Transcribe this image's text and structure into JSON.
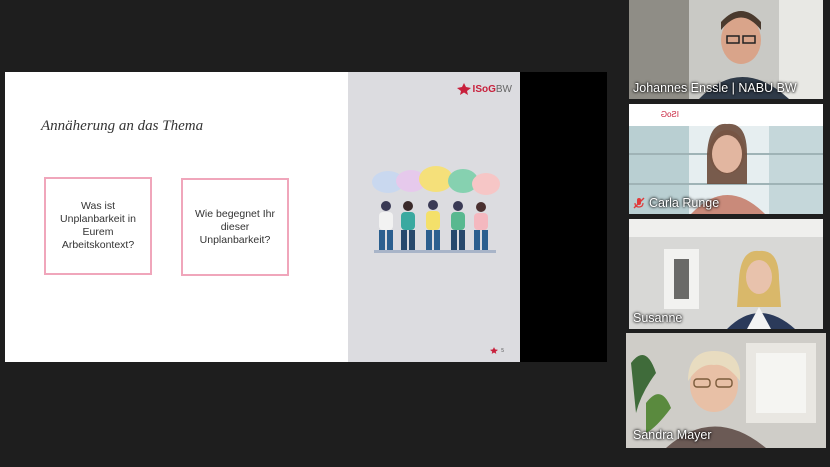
{
  "slide": {
    "title": "Annäherung an das Thema",
    "question1": "Was ist Unplanbarkeit in Eurem Arbeitskontext?",
    "question2": "Wie begegnet Ihr dieser Unplanbarkeit?",
    "logo_text": "ISoG",
    "logo_suffix": "BW",
    "page_number": "5"
  },
  "participants": [
    {
      "name": "Johannes Enssle | NABU BW",
      "muted": false,
      "active": false
    },
    {
      "name": "Carla Runge",
      "muted": true,
      "active": false
    },
    {
      "name": "Susanne",
      "muted": false,
      "active": false
    },
    {
      "name": "Sandra Mayer",
      "muted": false,
      "active": true
    }
  ],
  "colors": {
    "accent_box_border": "#f0a6bb",
    "logo_red": "#c8203c",
    "active_speaker_border": "#d6e85a",
    "mute_red": "#e03b3b"
  }
}
